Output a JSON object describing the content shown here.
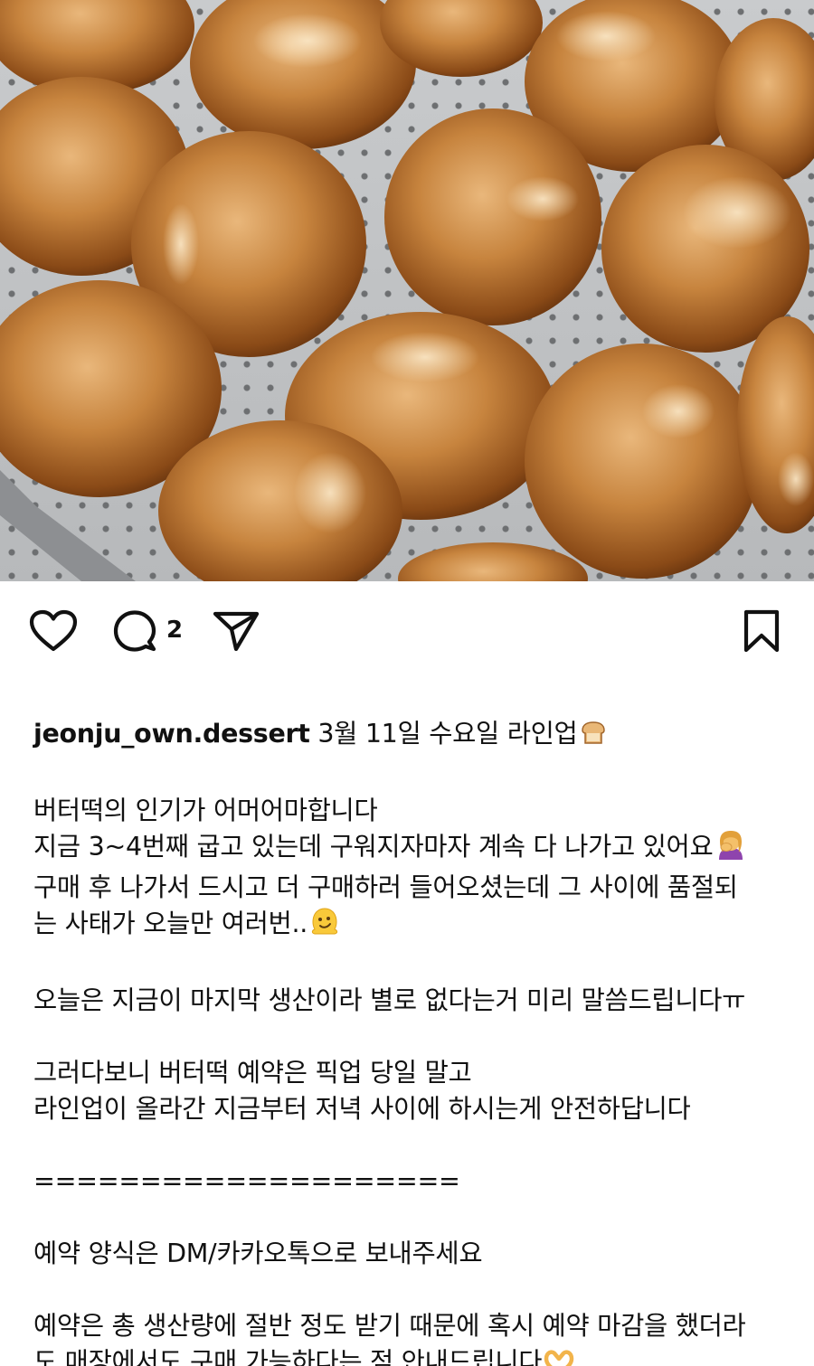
{
  "post": {
    "image_alt": "butter rice cakes on a perforated tray",
    "comment_count": "2"
  },
  "icons": {
    "like": "heart-icon",
    "comment": "speech-bubble-icon",
    "share": "paper-plane-icon",
    "save": "bookmark-icon"
  },
  "caption": {
    "username": "jeonju_own.dessert",
    "headline": " 3월 11일 수요일 라인업",
    "lines": [
      "버터떡의 인기가 어머어마합니다",
      "지금 3~4번째 굽고 있는데 구워지자마자 계속 다 나가고 있어요",
      "구매 후 나가서 드시고 더 구매하러 들어오셨는데 그 사이에 품절되",
      "는 사태가 오늘만 여러번..",
      "오늘은 지금이 마지막 생산이라 별로 없다는거 미리 말씀드립니다ㅠ",
      "그러다보니 버터떡 예약은 픽업 당일 말고",
      "라인업이 올라간 지금부터 저녁 사이에 하시는게 안전하답니다",
      "====================",
      "예약 양식은 DM/카카오톡으로 보내주세요",
      "예약은 총 생산량에 절반 정도 받기 때문에 혹시 예약 마감을 했더라",
      "도 매장에서도 구매 가능하다는 점 안내드립니다"
    ]
  },
  "colors": {
    "text": "#111111",
    "background": "#ffffff",
    "pastry_dark": "#7a3e12",
    "pastry_light": "#e7b57a"
  }
}
